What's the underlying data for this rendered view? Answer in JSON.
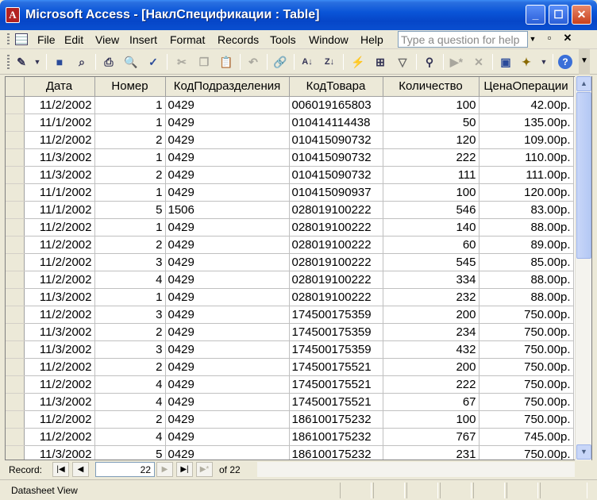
{
  "window": {
    "title": "Microsoft Access - [НаклСпецификации : Table]",
    "icon_letter": "A"
  },
  "menu": {
    "items": [
      "File",
      "Edit",
      "View",
      "Insert",
      "Format",
      "Records",
      "Tools",
      "Window",
      "Help"
    ],
    "help_placeholder": "Type a question for help"
  },
  "table": {
    "columns": [
      "Дата",
      "Номер",
      "КодПодразделения",
      "КодТовара",
      "Количество",
      "ЦенаОперации"
    ],
    "rows": [
      [
        "11/2/2002",
        "1",
        "0429",
        "006019165803",
        "100",
        "42.00р."
      ],
      [
        "11/1/2002",
        "1",
        "0429",
        "010414114438",
        "50",
        "135.00р."
      ],
      [
        "11/2/2002",
        "2",
        "0429",
        "010415090732",
        "120",
        "109.00р."
      ],
      [
        "11/3/2002",
        "1",
        "0429",
        "010415090732",
        "222",
        "110.00р."
      ],
      [
        "11/3/2002",
        "2",
        "0429",
        "010415090732",
        "111",
        "111.00р."
      ],
      [
        "11/1/2002",
        "1",
        "0429",
        "010415090937",
        "100",
        "120.00р."
      ],
      [
        "11/1/2002",
        "5",
        "1506",
        "028019100222",
        "546",
        "83.00р."
      ],
      [
        "11/2/2002",
        "1",
        "0429",
        "028019100222",
        "140",
        "88.00р."
      ],
      [
        "11/2/2002",
        "2",
        "0429",
        "028019100222",
        "60",
        "89.00р."
      ],
      [
        "11/2/2002",
        "3",
        "0429",
        "028019100222",
        "545",
        "85.00р."
      ],
      [
        "11/2/2002",
        "4",
        "0429",
        "028019100222",
        "334",
        "88.00р."
      ],
      [
        "11/3/2002",
        "1",
        "0429",
        "028019100222",
        "232",
        "88.00р."
      ],
      [
        "11/2/2002",
        "3",
        "0429",
        "174500175359",
        "200",
        "750.00р."
      ],
      [
        "11/3/2002",
        "2",
        "0429",
        "174500175359",
        "234",
        "750.00р."
      ],
      [
        "11/3/2002",
        "3",
        "0429",
        "174500175359",
        "432",
        "750.00р."
      ],
      [
        "11/2/2002",
        "2",
        "0429",
        "174500175521",
        "200",
        "750.00р."
      ],
      [
        "11/2/2002",
        "4",
        "0429",
        "174500175521",
        "222",
        "750.00р."
      ],
      [
        "11/3/2002",
        "4",
        "0429",
        "174500175521",
        "67",
        "750.00р."
      ],
      [
        "11/2/2002",
        "2",
        "0429",
        "186100175232",
        "100",
        "750.00р."
      ],
      [
        "11/2/2002",
        "4",
        "0429",
        "186100175232",
        "767",
        "745.00р."
      ],
      [
        "11/3/2002",
        "5",
        "0429",
        "186100175232",
        "231",
        "750.00р."
      ]
    ]
  },
  "record_nav": {
    "label": "Record:",
    "current": "22",
    "of_text": "of 22"
  },
  "status": {
    "text": "Datasheet View"
  }
}
